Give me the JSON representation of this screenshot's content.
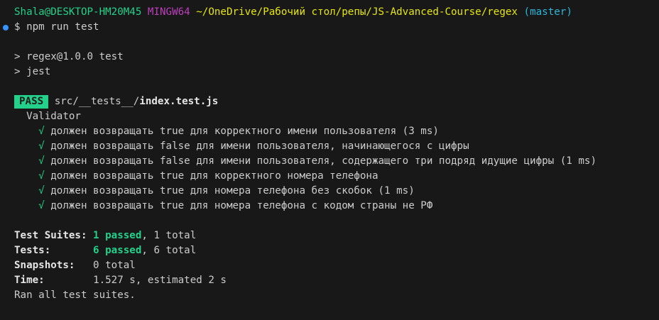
{
  "prompt": {
    "user_host": "Shala@DESKTOP-HM20M45",
    "env": "MINGW64",
    "path": "~/OneDrive/Рабочий стол/репы/JS-Advanced-Course/regex",
    "branch": "(master)",
    "symbol": "$",
    "command": "npm run test"
  },
  "npm_output": {
    "line1": "> regex@1.0.0 test",
    "line2": "> jest"
  },
  "result": {
    "badge": "PASS",
    "file_dir": "src/__tests__/",
    "file_name": "index.test.js",
    "suite_name": "Validator",
    "check_mark": "√",
    "tests": [
      "должен возвращать true для корректного имени пользователя (3 ms)",
      "должен возвращать false для имени пользователя, начинающегося с цифры",
      "должен возвращать false для имени пользователя, содержащего три подряд идущие цифры (1 ms)",
      "должен возвращать true для корректного номера телефона",
      "должен возвращать true для номера телефона без скобок (1 ms)",
      "должен возвращать true для номера телефона с кодом страны не РФ"
    ]
  },
  "summary": {
    "suites_label": "Test Suites:",
    "suites_passed": "1 passed",
    "suites_rest": ", 1 total",
    "tests_label": "Tests:",
    "tests_passed": "6 passed",
    "tests_rest": ", 6 total",
    "snapshots_label": "Snapshots:",
    "snapshots_value": "0 total",
    "time_label": "Time:",
    "time_value": "1.527 s, estimated 2 s",
    "final": "Ran all test suites."
  },
  "colors": {
    "background": "#181818",
    "pass_green": "#23d18b",
    "user_green": "#23d18b",
    "mingw_magenta": "#bc3fbc",
    "path_yellow": "#e5e510",
    "branch_cyan": "#29b8db",
    "prompt_dot_blue": "#3794ff"
  }
}
